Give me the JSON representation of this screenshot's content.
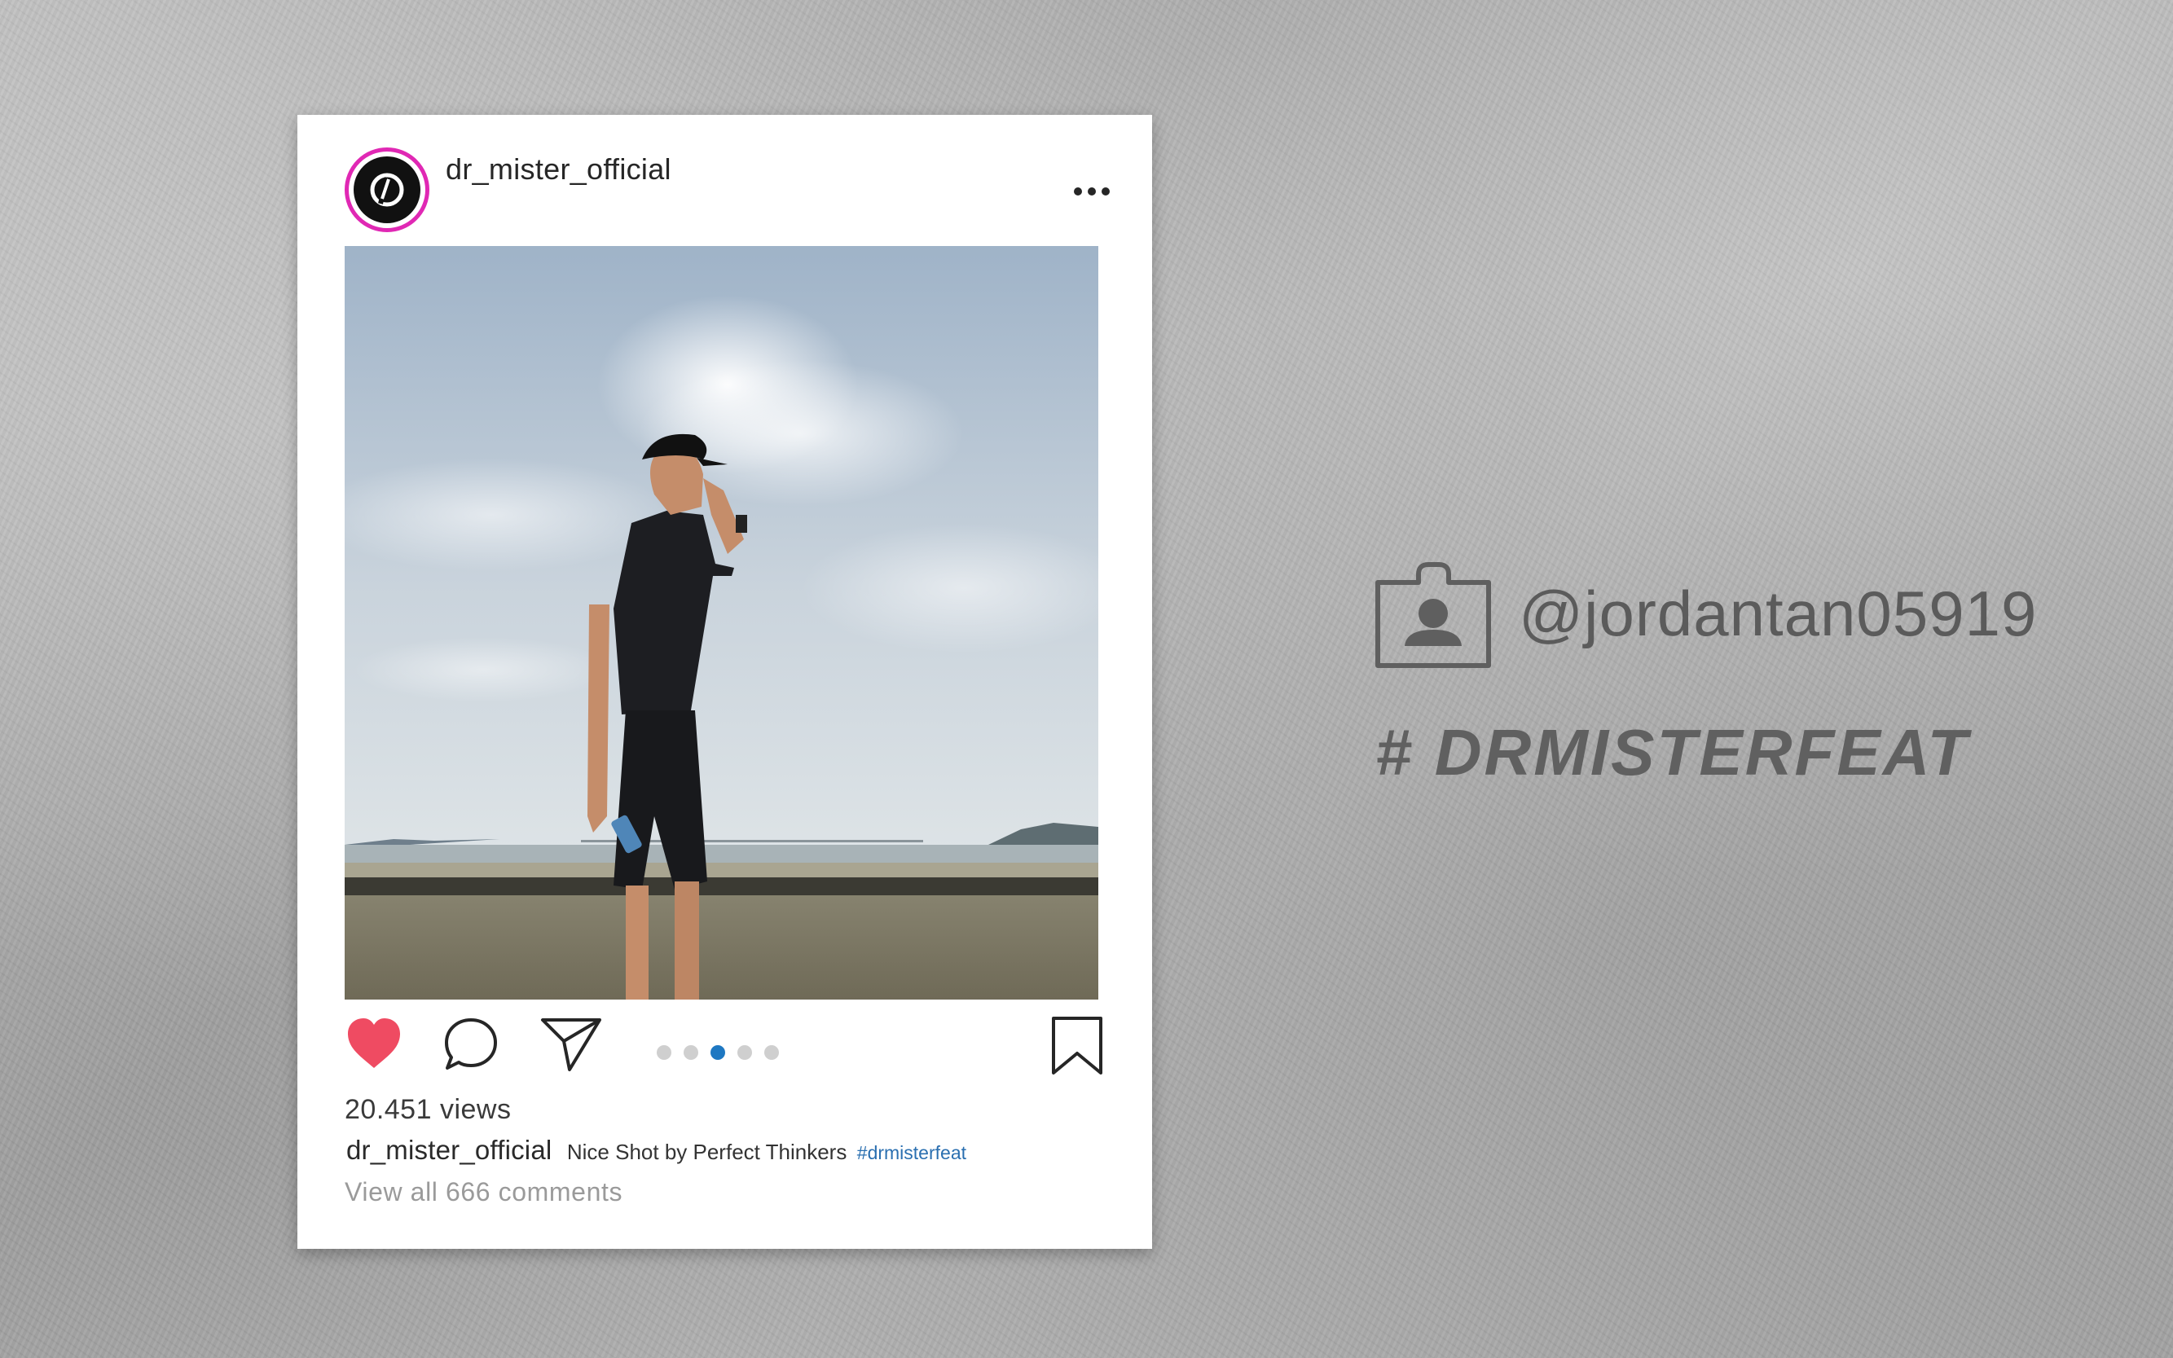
{
  "post": {
    "username": "dr_mister_official",
    "views": "20.451 views",
    "caption_user": "dr_mister_official",
    "caption_text": "Nice Shot by Perfect Thinkers",
    "caption_hashtag": "#drmisterfeat",
    "comments_link": "View all 666 comments",
    "liked": true,
    "carousel": {
      "count": 5,
      "active_index": 2
    }
  },
  "side": {
    "handle": "@jordantan05919",
    "hashtag": "# DRMISTERFEAT"
  },
  "icons": {
    "more": "more-icon",
    "like": "heart-icon",
    "comment": "comment-icon",
    "share": "send-icon",
    "save": "bookmark-icon",
    "profile": "profile-badge-icon"
  },
  "colors": {
    "like": "#ef4b62",
    "avatar_ring": "#e028b4",
    "carousel_active": "#1e78c2",
    "hashtag_link": "#2a6fb0"
  }
}
